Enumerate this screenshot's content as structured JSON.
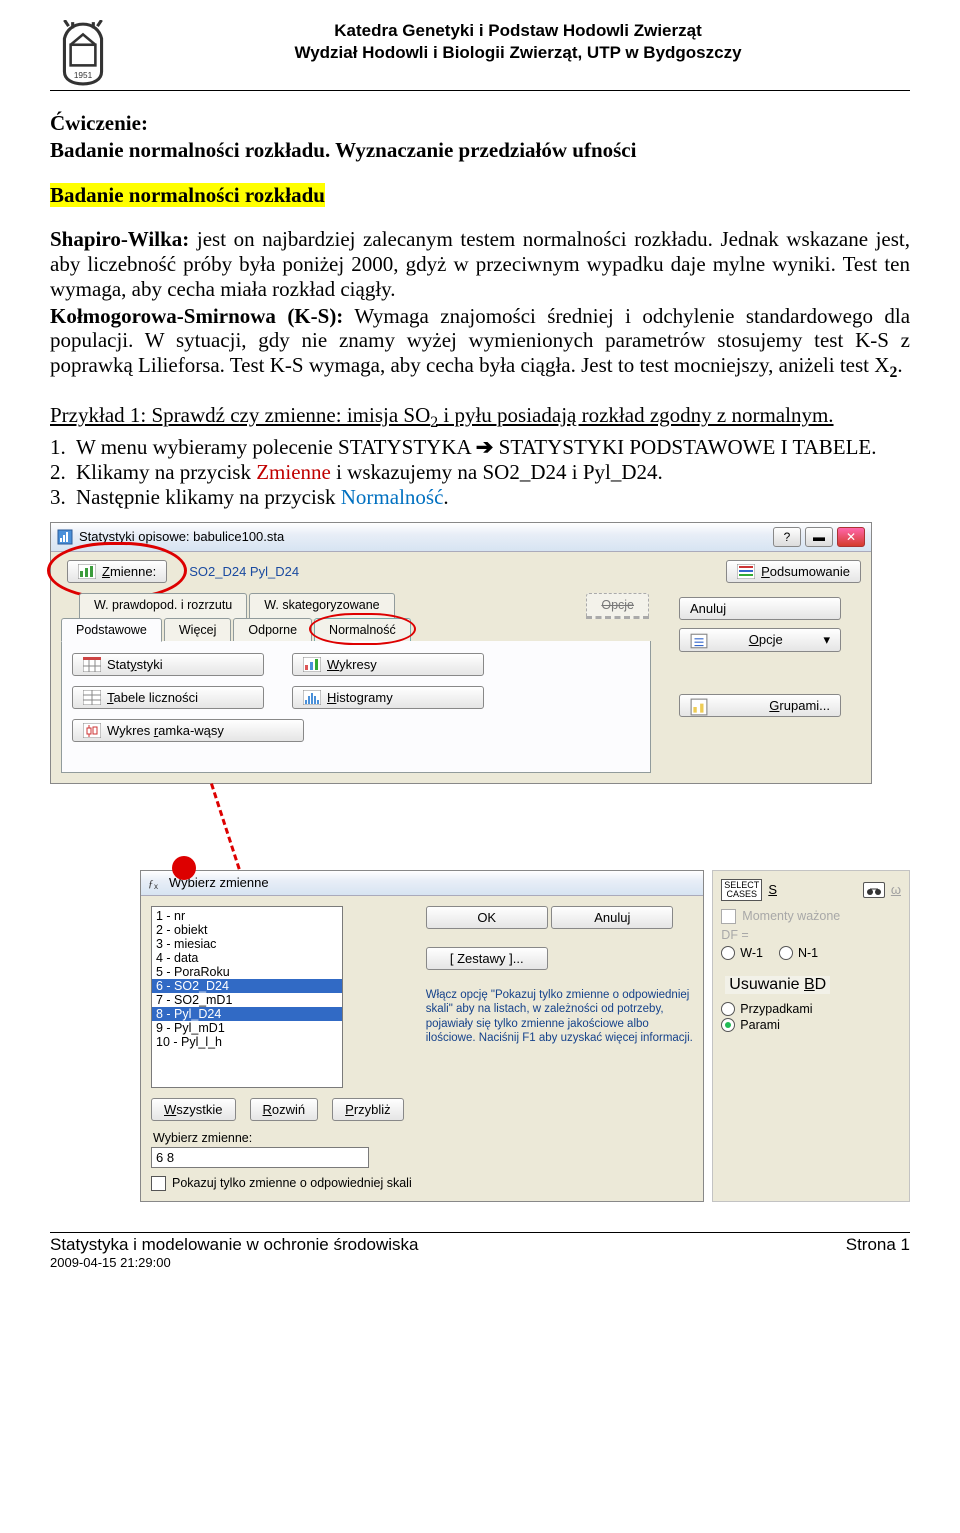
{
  "header": {
    "line1": "Katedra Genetyki i Podstaw Hodowli Zwierząt",
    "line2": "Wydział Hodowli i Biologii Zwierząt, UTP w Bydgoszczy"
  },
  "doc": {
    "title_prefix": "Ćwiczenie:",
    "title_rest": "Badanie normalności rozkładu. Wyznaczanie przedziałów ufności",
    "heading": "Badanie normalności rozkładu",
    "p_shapiro_lead": "Shapiro-Wilka:",
    "p_shapiro_body": "jest on najbardziej zalecanym testem normalności rozkładu. Jednak wskazane jest, aby liczebność próby była poniżej 2000, gdyż w przeciwnym wypadku daje mylne wyniki. Test ten wymaga, aby cecha miała rozkład ciągły.",
    "p_ks_lead": "Kołmogorowa-Smirnowa (K-S):",
    "p_ks_body": "Wymaga znajomości średniej i odchylenie standardowego dla populacji. W sytuacji, gdy nie znamy wyżej wymienionych parametrów stosujemy test K-S z poprawką Lilieforsa. Test K-S wymaga, aby cecha była ciągła. Jest to test mocniejszy, aniżeli test X",
    "p_ks_sup": "2",
    "p_ks_tail": ".",
    "example": "Przykład 1: Sprawdź czy zmienne: imisja SO",
    "example_sub": "2",
    "example_tail": " i pyłu posiadają rozkład zgodny z normalnym.",
    "steps": {
      "s1a": "W menu wybieramy polecenie STATYSTYKA ",
      "s1arrow": "➔",
      "s1b": " STATYSTYKI PODSTAWOWE I TABELE.",
      "s2a": "Klikamy na przycisk ",
      "s2b": "Zmienne",
      "s2c": " i wskazujemy na SO2_D24 i Pyl_D24.",
      "s3a": "Następnie klikamy na przycisk ",
      "s3b": "Normalność",
      "s3c": "."
    }
  },
  "win1": {
    "title": "Statystyki opisowe: babulice100.sta",
    "zmienne_btn": "Zmienne:",
    "zmienne_val": "SO2_D24 Pyl_D24",
    "podsumowanie": "Podsumowanie",
    "tabs": {
      "t1": "Podstawowe",
      "t2": "Więcej",
      "t3": "W. prawdopod. i rozrzutu",
      "t4": "W. skategoryzowane",
      "t5": "Odporne",
      "t6": "Opcje",
      "t7": "Normalność"
    },
    "anuluj": "Anuluj",
    "opcje": "Opcje",
    "grupami": "Grupami...",
    "btn_statystyki": "Statystyki",
    "btn_wykresy": "Wykresy",
    "btn_tabele": "Tabele liczności",
    "btn_hist": "Histogramy",
    "btn_ramka": "Wykres ramka-wąsy"
  },
  "win2": {
    "title": "Wybierz zmienne",
    "vars": [
      "1 - nr",
      "2 - obiekt",
      "3 - miesiac",
      "4 - data",
      "5 - PoraRoku",
      "6 - SO2_D24",
      "7 - SO2_mD1",
      "8 - Pyl_D24",
      "9 - Pyl_mD1",
      "10 - Pyl_l_h"
    ],
    "ok": "OK",
    "anuluj": "Anuluj",
    "zestawy": "[ Zestawy ]...",
    "hint": "Włącz opcję \"Pokazuj tylko zmienne o odpowiedniej skali\" aby na listach, w zależności od potrzeby, pojawiały się tylko zmienne jakościowe albo ilościowe. Naciśnij F1 aby uzyskać więcej informacji.",
    "wszystkie": "Wszystkie",
    "rozwin": "Rozwiń",
    "przybliz": "Przybliż",
    "wybierz_lbl": "Wybierz zmienne:",
    "wybierz_val": "6 8",
    "pokazuj": "Pokazuj tylko zmienne o odpowiedniej skali",
    "right": {
      "select_cases": "SELECT CASES",
      "s_u": "S",
      "momenty": "Momenty ważone",
      "df": "DF =",
      "w1": "W-1",
      "n1": "N-1",
      "usuw": "Usuwanie BD",
      "przypad": "Przypadkami",
      "parami": "Parami"
    }
  },
  "footer": {
    "left": "Statystyka i modelowanie w ochronie środowiska",
    "right": "Strona 1",
    "dt": "2009-04-15 21:29:00"
  }
}
